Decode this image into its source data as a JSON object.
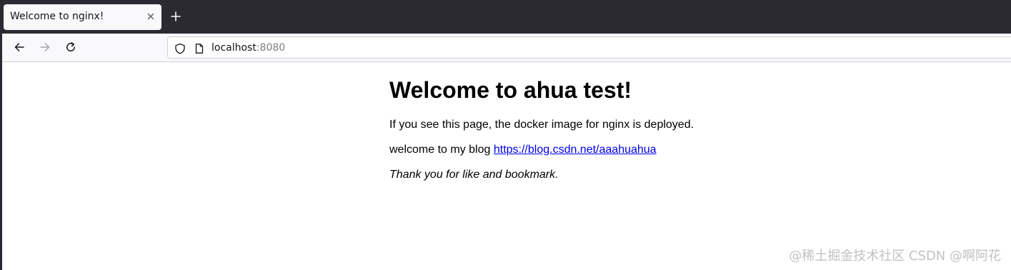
{
  "browser": {
    "tab": {
      "title": "Welcome to nginx!",
      "close_icon": "close-icon"
    },
    "new_tab_icon": "plus-icon",
    "nav": {
      "back_icon": "arrow-left-icon",
      "forward_icon": "arrow-right-icon",
      "reload_icon": "reload-icon"
    },
    "urlbar": {
      "shield_icon": "shield-icon",
      "page_icon": "page-icon",
      "host": "localhost",
      "port": ":8080"
    }
  },
  "page": {
    "heading": "Welcome to ahua test!",
    "line1": "If you see this page, the docker image for nginx is deployed.",
    "line2_prefix": "welcome to my blog",
    "line2_link": "https://blog.csdn.net/aaahuahua",
    "line3": "Thank you for like and bookmark."
  },
  "watermark": "@稀土掘金技术社区 CSDN @啊阿花"
}
